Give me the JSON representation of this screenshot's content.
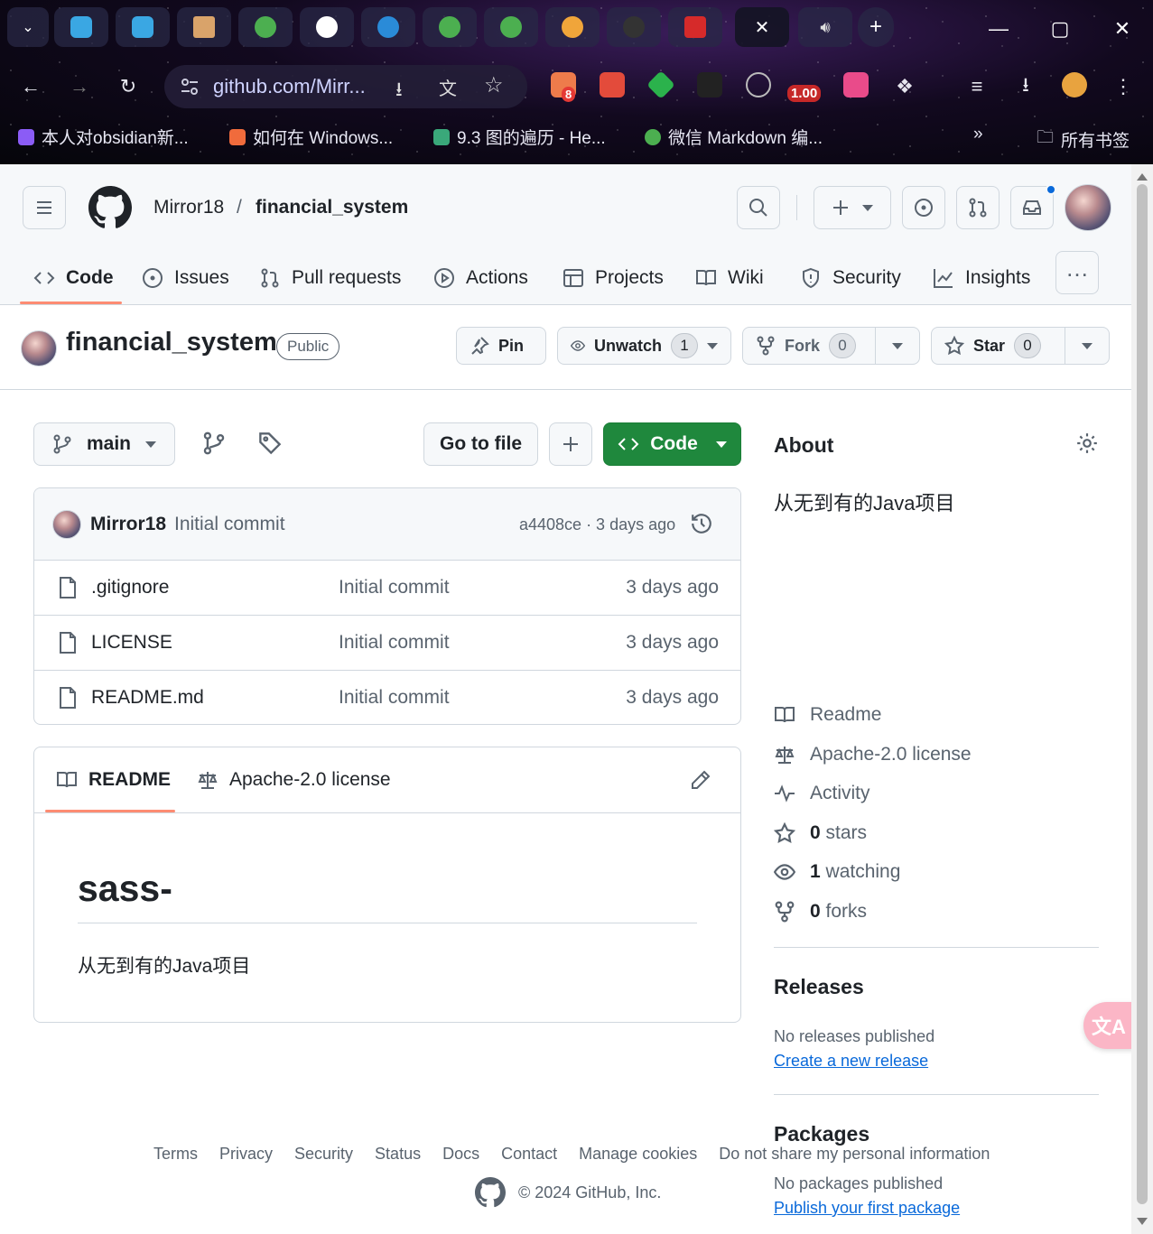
{
  "browser": {
    "url": "github.com/Mirr...",
    "extension_badges": {
      "ext1": "8",
      "speed": "1.00"
    },
    "bookmarks": [
      {
        "label": "本人对obsidian新..."
      },
      {
        "label": "如何在 Windows..."
      },
      {
        "label": "9.3   图的遍历 - He..."
      },
      {
        "label": "微信 Markdown 编..."
      }
    ],
    "bookmarks_overflow": "»",
    "all_bookmarks": "所有书签"
  },
  "header": {
    "owner": "Mirror18",
    "separator": "/",
    "repo": "financial_system"
  },
  "repo_nav": [
    {
      "label": "Code",
      "icon": "code-icon"
    },
    {
      "label": "Issues",
      "icon": "issue-icon"
    },
    {
      "label": "Pull requests",
      "icon": "pull-request-icon"
    },
    {
      "label": "Actions",
      "icon": "play-icon"
    },
    {
      "label": "Projects",
      "icon": "table-icon"
    },
    {
      "label": "Wiki",
      "icon": "book-icon"
    },
    {
      "label": "Security",
      "icon": "shield-icon"
    },
    {
      "label": "Insights",
      "icon": "graph-icon"
    }
  ],
  "repo_head": {
    "title": "financial_system",
    "visibility": "Public",
    "pin": "Pin",
    "unwatch": "Unwatch",
    "watch_count": "1",
    "fork": "Fork",
    "fork_count": "0",
    "star": "Star",
    "star_count": "0"
  },
  "file_nav": {
    "branch": "main",
    "go_to_file": "Go to file",
    "code": "Code"
  },
  "latest_commit": {
    "author": "Mirror18",
    "message": "Initial commit",
    "meta": "a4408ce · 3 days ago"
  },
  "files": [
    {
      "name": ".gitignore",
      "message": "Initial commit",
      "date": "3 days ago"
    },
    {
      "name": "LICENSE",
      "message": "Initial commit",
      "date": "3 days ago"
    },
    {
      "name": "README.md",
      "message": "Initial commit",
      "date": "3 days ago"
    }
  ],
  "readme": {
    "tab_readme": "README",
    "tab_license": "Apache-2.0 license",
    "heading": "sass-",
    "body": "从无到有的Java项目"
  },
  "about": {
    "title": "About",
    "description": "从无到有的Java项目",
    "readme": "Readme",
    "license": "Apache-2.0 license",
    "activity": "Activity",
    "stars_count": "0",
    "stars_label": "stars",
    "watching_count": "1",
    "watching_label": "watching",
    "forks_count": "0",
    "forks_label": "forks"
  },
  "releases": {
    "title": "Releases",
    "empty": "No releases published",
    "link": "Create a new release"
  },
  "packages": {
    "title": "Packages",
    "empty": "No packages published",
    "link": "Publish your first package"
  },
  "footer": {
    "links": [
      "Terms",
      "Privacy",
      "Security",
      "Status",
      "Docs",
      "Contact",
      "Manage cookies",
      "Do not share my personal information"
    ],
    "copyright": "© 2024 GitHub, Inc."
  },
  "colors": {
    "accent_green": "#1f883d",
    "link_blue": "#0969da",
    "underline_orange": "#fd8c73"
  }
}
